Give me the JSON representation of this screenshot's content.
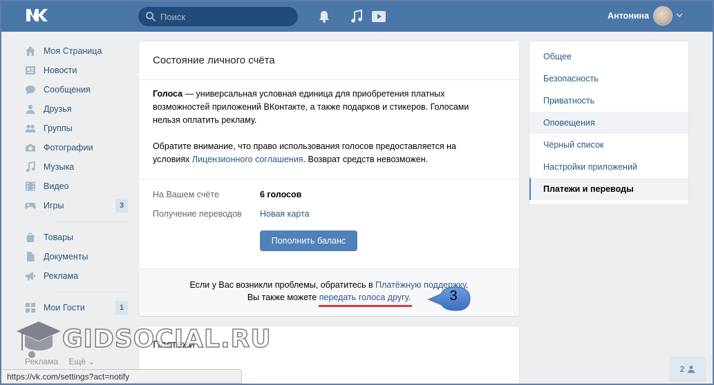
{
  "header": {
    "search_placeholder": "Поиск",
    "user_name": "Антонина"
  },
  "left_menu": {
    "items": [
      {
        "label": "Моя Страница",
        "icon": "home-icon"
      },
      {
        "label": "Новости",
        "icon": "news-icon"
      },
      {
        "label": "Сообщения",
        "icon": "messages-icon"
      },
      {
        "label": "Друзья",
        "icon": "friends-icon"
      },
      {
        "label": "Группы",
        "icon": "groups-icon"
      },
      {
        "label": "Фотографии",
        "icon": "camera-icon"
      },
      {
        "label": "Музыка",
        "icon": "music-icon"
      },
      {
        "label": "Видео",
        "icon": "video-icon"
      },
      {
        "label": "Игры",
        "icon": "gamepad-icon",
        "badge": "3"
      }
    ],
    "items2": [
      {
        "label": "Товары",
        "icon": "bag-icon"
      },
      {
        "label": "Документы",
        "icon": "document-icon"
      },
      {
        "label": "Реклама",
        "icon": "megaphone-icon"
      }
    ],
    "items3": [
      {
        "label": "Мои Гости",
        "icon": "grid-icon",
        "badge": "1"
      }
    ]
  },
  "footer": {
    "link1": "Реклама",
    "link2": "Ещё ⌄",
    "status_url": "https://vk.com/settings?act=notify"
  },
  "panel": {
    "title": "Состояние личного счёта",
    "desc_bold": "Голоса",
    "desc_rest": " — универсальная условная единица для приобретения платных возможностей приложений ВКонтакте, а также подарков и стикеров. Голосами нельзя оплатить рекламу.",
    "note_start": "Обратите внимание, что право использования голосов предоставляется на условиях ",
    "note_link": "Лицензионного соглашения",
    "note_end": ". Возврат средств невозможен.",
    "balance_label": "На Вашем счёте",
    "balance_value": "6 голосов",
    "transfers_label": "Получение переводов",
    "transfers_value": "Новая карта",
    "topup_button": "Пополнить баланс",
    "foot_line1_start": "Если у Вас возникли проблемы, обратитесь в ",
    "foot_line1_link": "Платёжную поддержку",
    "foot_line1_end": ".",
    "foot_line2_start": "Вы также можете ",
    "foot_line2_link": "передать голоса другу",
    "foot_line2_end": "."
  },
  "callout": {
    "number": "3"
  },
  "panel2": {
    "title": "Платежи"
  },
  "settings_menu": {
    "items": [
      "Общее",
      "Безопасность",
      "Приватность",
      "Оповещения",
      "Чёрный список",
      "Настройки приложений",
      "Платежи и переводы"
    ]
  },
  "friends_online": {
    "count": "2"
  },
  "watermark": {
    "text": "GIDSOCIAL.RU"
  },
  "colors": {
    "header": "#4a76a8",
    "link": "#2a5885",
    "button": "#5181b8",
    "callout": "#4a7cc8",
    "underline": "#e0393e"
  }
}
